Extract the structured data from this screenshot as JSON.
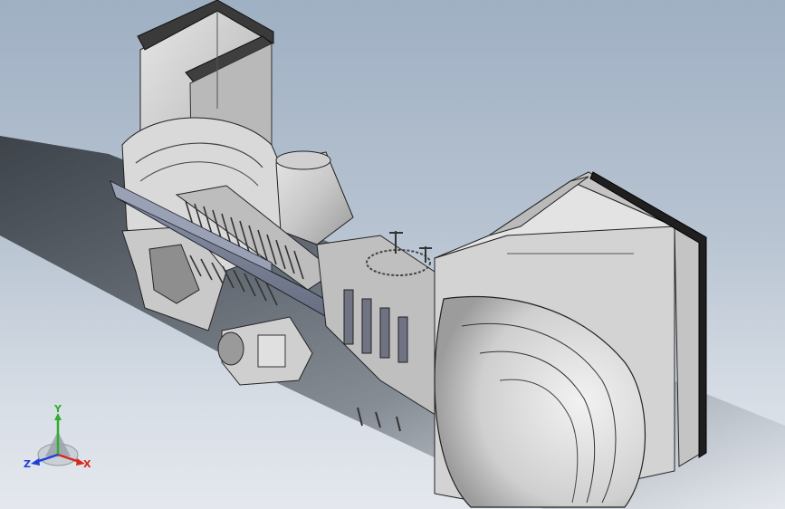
{
  "triad": {
    "x_label": "X",
    "y_label": "Y",
    "z_label": "Z",
    "x_color": "#d42b1e",
    "y_color": "#2fae2f",
    "z_color": "#1f3fd6"
  },
  "model": {
    "part_icon": "gas-turbine-cutaway-model"
  }
}
